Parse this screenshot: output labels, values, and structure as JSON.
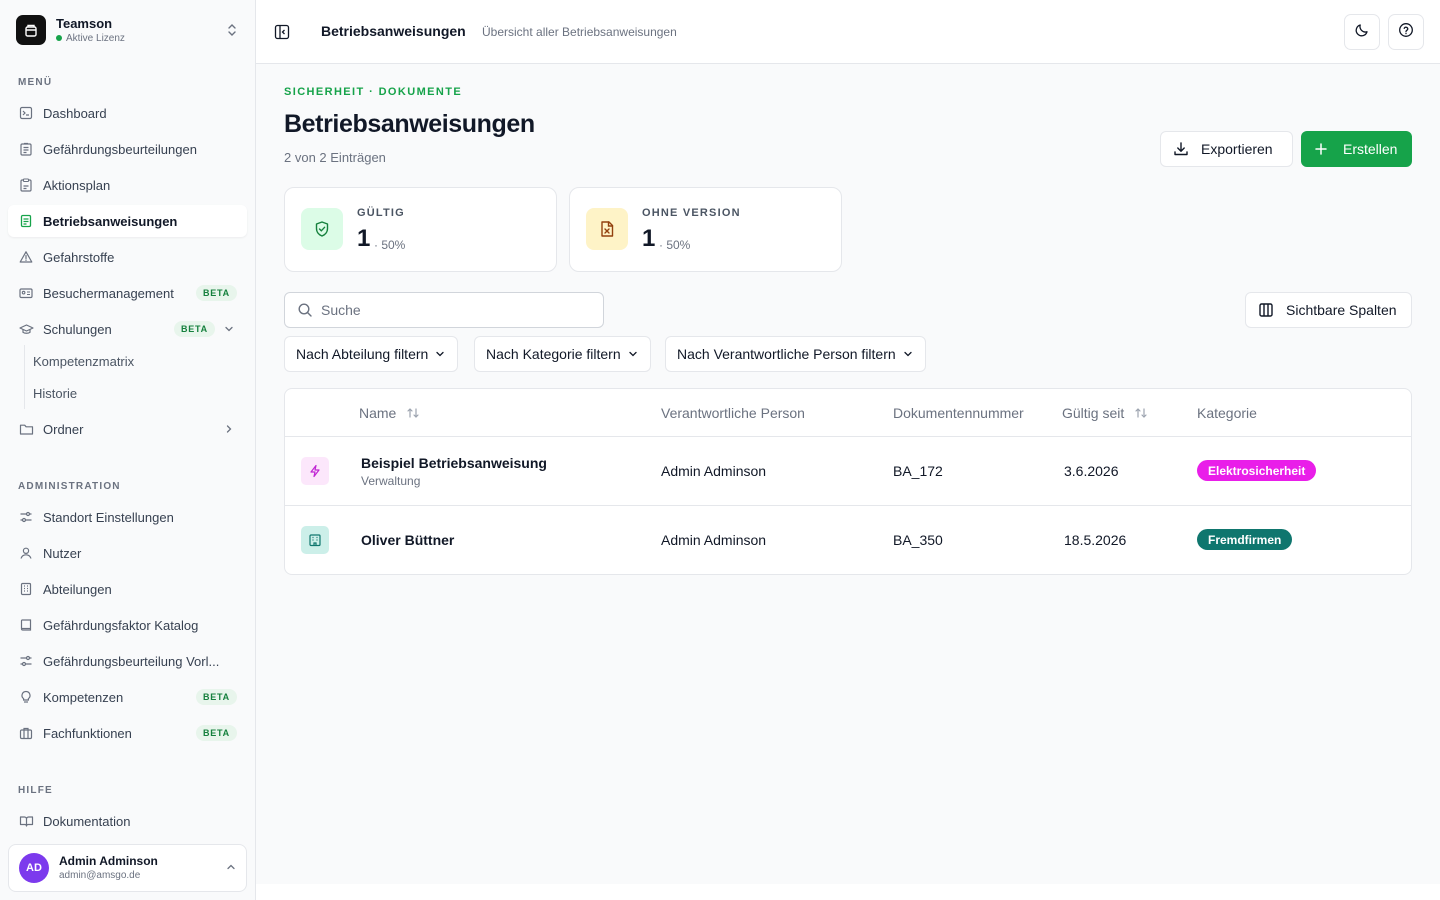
{
  "brand": {
    "name": "Teamson",
    "license": "Aktive Lizenz"
  },
  "sidebar": {
    "menu_label": "MENÜ",
    "items": [
      {
        "label": "Dashboard",
        "icon": "dashboard-icon"
      },
      {
        "label": "Gefährdungsbeurteilungen",
        "icon": "clipboard-list-icon"
      },
      {
        "label": "Aktionsplan",
        "icon": "clipboard-check-icon"
      },
      {
        "label": "Betriebsanweisungen",
        "icon": "document-icon",
        "active": true
      },
      {
        "label": "Gefahrstoffe",
        "icon": "warning-triangle-icon"
      },
      {
        "label": "Besuchermanagement",
        "icon": "id-card-icon",
        "badge": "BETA"
      },
      {
        "label": "Schulungen",
        "icon": "graduation-cap-icon",
        "badge": "BETA"
      },
      {
        "label": "Ordner",
        "icon": "folder-icon"
      }
    ],
    "sub_items": [
      "Kompetenzmatrix",
      "Historie"
    ],
    "admin_label": "ADMINISTRATION",
    "admin_items": [
      {
        "label": "Standort Einstellungen",
        "icon": "sliders-icon"
      },
      {
        "label": "Nutzer",
        "icon": "user-icon"
      },
      {
        "label": "Abteilungen",
        "icon": "building-icon"
      },
      {
        "label": "Gefährdungsfaktor Katalog",
        "icon": "book-icon"
      },
      {
        "label": "Gefährdungsbeurteilung Vorl...",
        "icon": "sliders-icon"
      },
      {
        "label": "Kompetenzen",
        "icon": "lightbulb-icon",
        "badge": "BETA"
      },
      {
        "label": "Fachfunktionen",
        "icon": "briefcase-icon",
        "badge": "BETA"
      }
    ],
    "help_label": "HILFE",
    "help_items": [
      {
        "label": "Dokumentation",
        "icon": "open-book-icon"
      }
    ]
  },
  "user": {
    "initials": "AD",
    "name": "Admin Adminson",
    "email": "admin@amsgo.de"
  },
  "topbar": {
    "title": "Betriebsanweisungen",
    "subtitle": "Übersicht aller Betriebsanweisungen"
  },
  "page": {
    "eyebrow": "SICHERHEIT · DOKUMENTE",
    "title": "Betriebsanweisungen",
    "count": "2 von 2 Einträgen",
    "export_label": "Exportieren",
    "create_label": "Erstellen"
  },
  "stats": [
    {
      "label": "GÜLTIG",
      "value": "1",
      "pct": "· 50%",
      "icon": "shield-check-icon",
      "bg": "#dcfce7",
      "color": "#15803d"
    },
    {
      "label": "OHNE VERSION",
      "value": "1",
      "pct": "· 50%",
      "icon": "file-x-icon",
      "bg": "#fef3c7",
      "color": "#92400e"
    }
  ],
  "search": {
    "placeholder": "Suche"
  },
  "columns_button": "Sichtbare Spalten",
  "filters": [
    "Nach Abteilung filtern",
    "Nach Kategorie filtern",
    "Nach Verantwortliche Person filtern"
  ],
  "table": {
    "headers": [
      "Name",
      "Verantwortliche Person",
      "Dokumentennummer",
      "Gültig seit",
      "Kategorie"
    ],
    "rows": [
      {
        "name": "Beispiel Betriebsanweisung",
        "sub": "Verwaltung",
        "person": "Admin Adminson",
        "doc": "BA_172",
        "date": "3.6.2026",
        "category": "Elektrosicherheit",
        "cat_color": "#e91ee9",
        "icon": "lightning-icon",
        "icon_bg": "#fce7fb",
        "icon_color": "#c026d3"
      },
      {
        "name": "Oliver Büttner",
        "sub": "",
        "person": "Admin Adminson",
        "doc": "BA_350",
        "date": "18.5.2026",
        "category": "Fremdfirmen",
        "cat_color": "#0f766e",
        "icon": "factory-icon",
        "icon_bg": "#ccefe9",
        "icon_color": "#0f766e"
      }
    ]
  }
}
